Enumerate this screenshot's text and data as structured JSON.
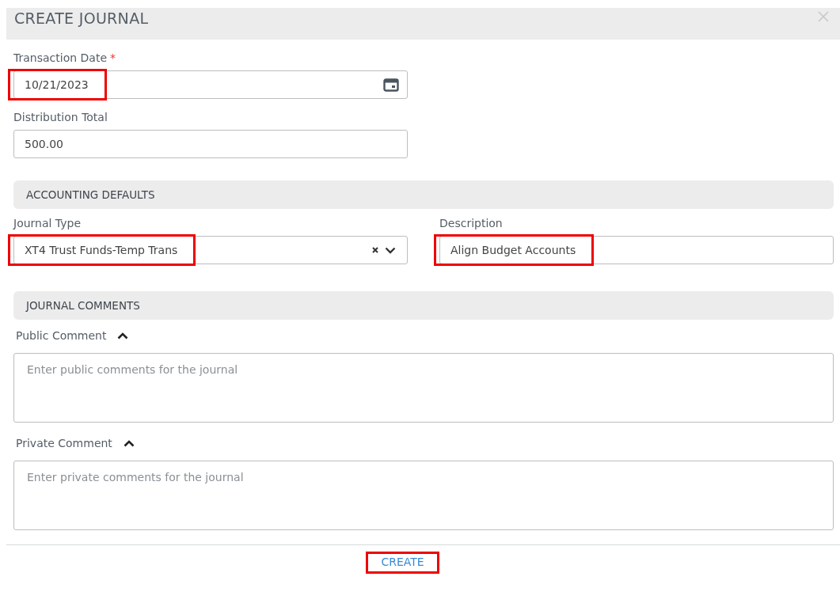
{
  "dialog": {
    "title": "CREATE JOURNAL"
  },
  "fields": [
    {
      "kind": "date",
      "label": "Transaction Date",
      "required_mark": "*",
      "value": "10/21/2023",
      "highlighted": true
    },
    {
      "kind": "text",
      "label": "Distribution Total",
      "value": "500.00",
      "highlighted": false
    }
  ],
  "accounting_defaults": {
    "title": "ACCOUNTING DEFAULTS",
    "fields": [
      {
        "kind": "select",
        "label": "Journal Type",
        "value": "XT4 Trust Funds-Temp Trans",
        "highlighted": true
      },
      {
        "kind": "text",
        "label": "Description",
        "value": "Align Budget Accounts",
        "highlighted": true
      }
    ]
  },
  "journal_comments": {
    "title": "JOURNAL COMMENTS",
    "comments": [
      {
        "label": "Public Comment",
        "expanded": true,
        "placeholder": "Enter public comments for the journal"
      },
      {
        "label": "Private Comment",
        "expanded": true,
        "placeholder": "Enter private comments for the journal"
      }
    ]
  },
  "create_button": {
    "label": "CREATE",
    "highlighted": true
  }
}
